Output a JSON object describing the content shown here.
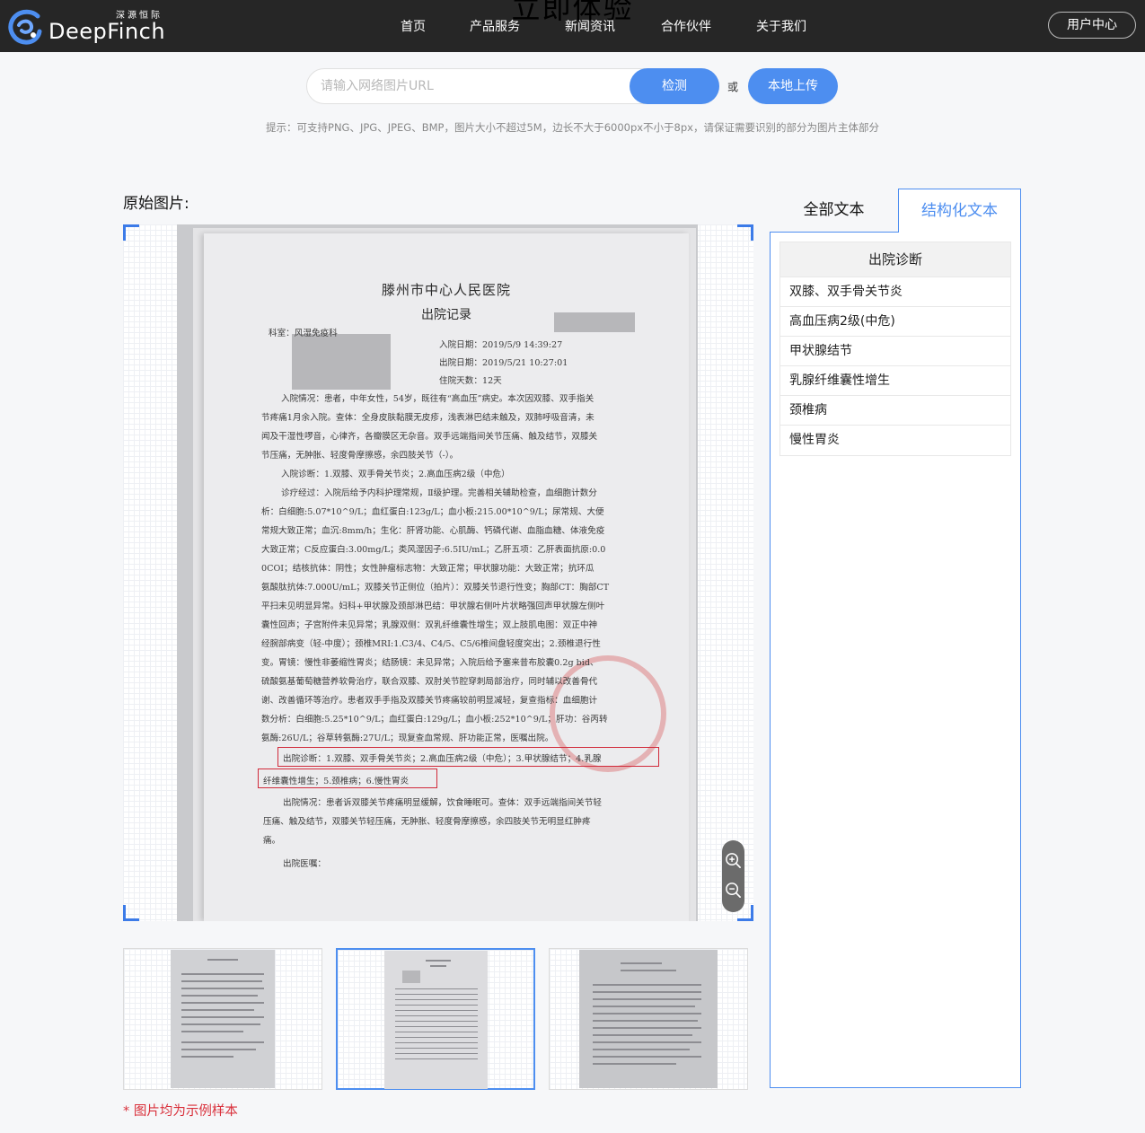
{
  "header": {
    "logo_cn": "深源恒际",
    "logo_en": "DeepFinch",
    "ghost_title": "立即体验",
    "nav": [
      "首页",
      "产品服务",
      "新闻资讯",
      "合作伙伴",
      "关于我们"
    ],
    "user_center": "用户中心"
  },
  "search": {
    "placeholder": "请输入网络图片URL",
    "value": "",
    "detect_label": "检测",
    "or_label": "或",
    "upload_label": "本地上传",
    "hint": "提示：可支持PNG、JPG、JPEG、BMP，图片大小不超过5M，边长不大于6000px不小于8px，请保证需要识别的部分为图片主体部分"
  },
  "original": {
    "title": "原始图片:",
    "document": {
      "hospital": "滕州市中心人民医院",
      "record": "出院记录",
      "lines": [
        "科室：风湿免疫科",
        "入院日期：2019/5/9 14:39:27",
        "出院日期：2019/5/21 10:27:01",
        "住院天数：12天",
        "入院情况：患者，中年女性，54岁，既往有“高血压”病史。本次因双膝、双手指关",
        "节疼痛1月余入院。查体：全身皮肤黏膜无皮疹，浅表淋巴结未触及，双肺呼吸音清，未",
        "闻及干湿性啰音，心律齐，各瓣膜区无杂音。双手远端指间关节压痛、触及结节，双膝关",
        "节压痛，无肿胀、轻度骨摩擦感，余四肢关节（-）。",
        "入院诊断：1.双膝、双手骨关节炎；2.高血压病2级（中危）",
        "诊疗经过：入院后给予内科护理常规，Ⅱ级护理。完善相关辅助检查，血细胞计数分",
        "析：白细胞:5.07*10^9/L；血红蛋白:123g/L；血小板:215.00*10^9/L；尿常规、大便",
        "常规大致正常；血沉:8mm/h；生化：肝肾功能、心肌酶、钙磷代谢、血脂血糖、体液免疫",
        "大致正常；C反应蛋白:3.00mg/L；类风湿因子:6.5IU/mL；乙肝五项：乙肝表面抗原:0.0",
        "0COI；结核抗体：阴性；女性肿瘤标志物：大致正常；甲状腺功能：大致正常；抗环瓜",
        "氨酸肽抗体:7.000U/mL；双膝关节正侧位（拍片）：双膝关节退行性变；胸部CT：胸部CT",
        "平扫未见明显异常。妇科+甲状腺及颈部淋巴结：甲状腺右侧叶片状略强回声甲状腺左侧叶",
        "囊性回声；子宫附件未见异常；乳腺双侧：双乳纤维囊性增生；双上肢肌电图：双正中神",
        "经腕部病变（轻-中度）；颈椎MRI:1.C3/4、C4/5、C5/6椎间盘轻度突出；2.颈椎退行性",
        "变。胃镜：慢性非萎缩性胃炎；结肠镜：未见异常；入院后给予塞来昔布胶囊0.2g bid、",
        "硫酸氨基葡萄糖营养软骨治疗，联合双膝、双肘关节腔穿刺局部治疗，同时辅以改善骨代",
        "谢、改善循环等治疗。患者双手手指及双膝关节疼痛较前明显减轻，复查指标：血细胞计",
        "数分析：白细胞:5.25*10^9/L；血红蛋白:129g/L；血小板:252*10^9/L；肝功：谷丙转",
        "氨酶:26U/L；谷草转氨酶:27U/L；现复查血常规、肝功能正常，医嘱出院。",
        "出院诊断：1.双膝、双手骨关节炎；2.高血压病2级（中危）；3.甲状腺结节；4.乳腺",
        "纤维囊性增生；5.颈椎病；6.慢性胃炎",
        "出院情况：患者诉双膝关节疼痛明显缓解，饮食睡眠可。查体：双手远端指间关节轻",
        "压痛、触及结节，双膝关节轻压痛，无肿胀、轻度骨摩擦感，余四肢关节无明显红肿疼",
        "痛。",
        "出院医嘱："
      ]
    }
  },
  "samples": {
    "note": "* 图片均为示例样本",
    "active_index": 1
  },
  "tabs": {
    "all_text": "全部文本",
    "structured_text": "结构化文本",
    "active": "structured_text"
  },
  "result": {
    "header": "出院诊断",
    "rows": [
      "双膝、双手骨关节炎",
      "高血压病2级(中危)",
      "甲状腺结节",
      "乳腺纤维囊性增生",
      "颈椎病",
      "慢性胃炎"
    ]
  },
  "colors": {
    "accent": "#4d8ef0",
    "topbar": "#262626",
    "highlight_box": "#d12a3a",
    "note_red": "#d9303b"
  },
  "icons": {
    "zoom_in": "zoom-in-icon",
    "zoom_out": "zoom-out-icon",
    "logo": "deepfinch-logo-icon"
  }
}
